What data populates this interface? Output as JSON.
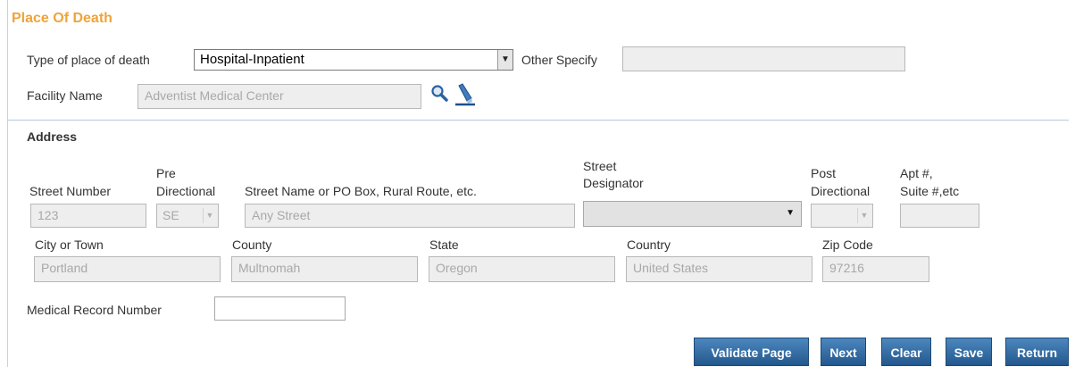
{
  "section": {
    "title": "Place Of Death"
  },
  "place_type": {
    "label": "Type of place of death",
    "selected": "Hospital-Inpatient",
    "other_label": "Other Specify",
    "other_value": ""
  },
  "facility": {
    "label": "Facility Name",
    "value": "Adventist Medical Center"
  },
  "address": {
    "heading": "Address",
    "street_number": {
      "label": "Street Number",
      "value": "123"
    },
    "pre_directional": {
      "label_line1": "Pre",
      "label_line2": "Directional",
      "value": "SE"
    },
    "street_name": {
      "label": "Street Name or PO Box, Rural Route, etc.",
      "value": "Any Street"
    },
    "street_designator": {
      "label_line1": "Street",
      "label_line2": "Designator",
      "value": ""
    },
    "post_directional": {
      "label_line1": "Post",
      "label_line2": "Directional",
      "value": ""
    },
    "apt": {
      "label_line1": "Apt #,",
      "label_line2": "Suite #,etc",
      "value": ""
    },
    "city": {
      "label": "City or Town",
      "value": "Portland"
    },
    "county": {
      "label": "County",
      "value": "Multnomah"
    },
    "state": {
      "label": "State",
      "value": "Oregon"
    },
    "country": {
      "label": "Country",
      "value": "United States"
    },
    "zip": {
      "label": "Zip Code",
      "value": "97216"
    }
  },
  "medical_record": {
    "label": "Medical Record Number",
    "value": ""
  },
  "buttons": {
    "validate": "Validate Page",
    "next": "Next",
    "clear": "Clear",
    "save": "Save",
    "return": "Return"
  },
  "colors": {
    "section_title": "#f0a33a",
    "button_bg": "#2f6da4",
    "divider": "#b6c9dc",
    "disabled_field_bg": "#eeeeee"
  }
}
